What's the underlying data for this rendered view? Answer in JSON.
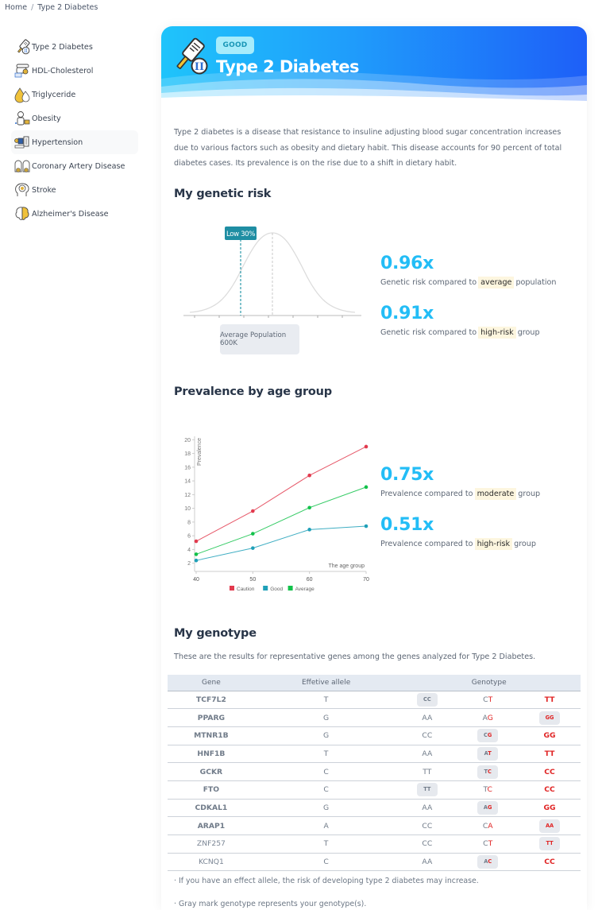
{
  "breadcrumb": {
    "home": "Home",
    "separator": "/",
    "current": "Type 2 Diabetes"
  },
  "sidebar": {
    "items": [
      {
        "label": "Type 2 Diabetes",
        "icon": "glucose-meter-icon"
      },
      {
        "label": "HDL-Cholesterol",
        "icon": "cholesterol-icon"
      },
      {
        "label": "Triglyceride",
        "icon": "fat-drops-icon"
      },
      {
        "label": "Obesity",
        "icon": "scale-person-icon"
      },
      {
        "label": "Hypertension",
        "icon": "blood-pressure-icon"
      },
      {
        "label": "Coronary Artery Disease",
        "icon": "heart-vessels-icon"
      },
      {
        "label": "Stroke",
        "icon": "brain-head-icon"
      },
      {
        "label": "Alzheimer's Disease",
        "icon": "brain-icon"
      }
    ]
  },
  "hero": {
    "badge": "GOOD",
    "title": "Type 2 Diabetes",
    "icon": "glucose-meter-icon",
    "accent_from": "#1fc4fb",
    "accent_to": "#1e5ff8"
  },
  "description": "Type 2 diabetes is a disease that resistance to insuline adjusting blood sugar concentration increases due to various factors such as obesity and dietary habit. This disease accounts for 90 percent of total diabetes cases. Its prevalence is on the rise due to a shift in dietary habit.",
  "genetic_risk": {
    "heading": "My genetic risk",
    "marker_label": "Low 30%",
    "marker_percentile": 30,
    "population_label": "Average Population 600K",
    "stats": [
      {
        "value": "0.96x",
        "prefix": "Genetic risk compared to",
        "highlight": "average",
        "suffix": "population"
      },
      {
        "value": "0.91x",
        "prefix": "Genetic risk compared to",
        "highlight": "high-risk",
        "suffix": "group"
      }
    ]
  },
  "prevalence": {
    "heading": "Prevalence by age group",
    "stats": [
      {
        "value": "0.75x",
        "prefix": "Prevalence compared to",
        "highlight": "moderate",
        "suffix": "group"
      },
      {
        "value": "0.51x",
        "prefix": "Prevalence compared to",
        "highlight": "high-risk",
        "suffix": "group"
      }
    ]
  },
  "chart_data": {
    "type": "line",
    "title": "",
    "xlabel": "The age group",
    "ylabel": "Prevalence",
    "x": [
      40,
      50,
      60,
      70
    ],
    "x_tick_labels": [
      "40",
      "50",
      "60",
      "70"
    ],
    "y_ticks": [
      2,
      4,
      6,
      8,
      10,
      12,
      14,
      16,
      18,
      20
    ],
    "ylim": [
      0.8,
      20.5
    ],
    "grid": false,
    "legend": "bottom",
    "series": [
      {
        "name": "Caution",
        "color": "#e23a4e",
        "values": [
          5.2,
          9.6,
          14.8,
          19.0
        ]
      },
      {
        "name": "Good",
        "color": "#1fa0b8",
        "values": [
          2.4,
          4.2,
          6.9,
          7.4
        ]
      },
      {
        "name": "Average",
        "color": "#12c24a",
        "values": [
          3.3,
          6.3,
          10.1,
          13.1
        ]
      }
    ]
  },
  "genotype": {
    "heading": "My genotype",
    "intro": "These are the results for representative genes among the genes analyzed for Type 2 Diabetes.",
    "columns": [
      "Gene",
      "Effetive allele",
      "Genotype"
    ],
    "rows": [
      {
        "gene": "TCF7L2",
        "bold": true,
        "allele": "T",
        "genotypes": [
          "CC",
          "CT",
          "TT"
        ],
        "mine": 0
      },
      {
        "gene": "PPARG",
        "bold": true,
        "allele": "G",
        "genotypes": [
          "AA",
          "AG",
          "GG"
        ],
        "mine": 2
      },
      {
        "gene": "MTNR1B",
        "bold": true,
        "allele": "G",
        "genotypes": [
          "CC",
          "CG",
          "GG"
        ],
        "mine": 1
      },
      {
        "gene": "HNF1B",
        "bold": true,
        "allele": "T",
        "genotypes": [
          "AA",
          "AT",
          "TT"
        ],
        "mine": 1
      },
      {
        "gene": "GCKR",
        "bold": true,
        "allele": "C",
        "genotypes": [
          "TT",
          "TC",
          "CC"
        ],
        "mine": 1
      },
      {
        "gene": "FTO",
        "bold": true,
        "allele": "C",
        "genotypes": [
          "TT",
          "TC",
          "CC"
        ],
        "mine": 0
      },
      {
        "gene": "CDKAL1",
        "bold": true,
        "allele": "G",
        "genotypes": [
          "AA",
          "AG",
          "GG"
        ],
        "mine": 1
      },
      {
        "gene": "ARAP1",
        "bold": true,
        "allele": "A",
        "genotypes": [
          "CC",
          "CA",
          "AA"
        ],
        "mine": 2
      },
      {
        "gene": "ZNF257",
        "bold": false,
        "allele": "T",
        "genotypes": [
          "CC",
          "CT",
          "TT"
        ],
        "mine": 2
      },
      {
        "gene": "KCNQ1",
        "bold": false,
        "allele": "C",
        "genotypes": [
          "AA",
          "AC",
          "CC"
        ],
        "mine": 1
      }
    ],
    "notes": [
      "· If you have an effect allele, the risk of developing type 2 diabetes may increase.",
      "· Gray mark genotype represents your genotype(s)."
    ]
  }
}
